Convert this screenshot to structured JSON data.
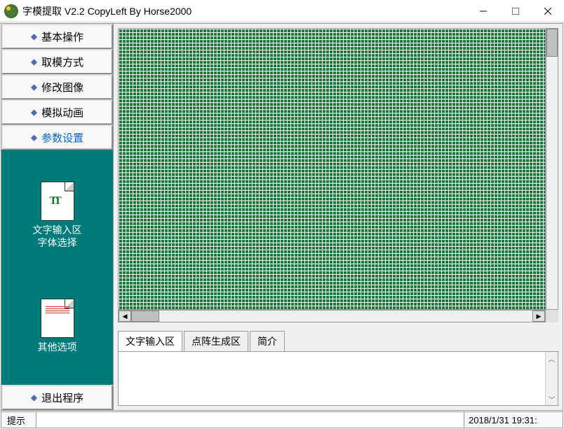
{
  "titlebar": {
    "title": "字模提取 V2.2  CopyLeft By Horse2000"
  },
  "sidebar": {
    "menu_items": [
      {
        "label": "基本操作",
        "active": false
      },
      {
        "label": "取模方式",
        "active": false
      },
      {
        "label": "修改图像",
        "active": false
      },
      {
        "label": "模拟动画",
        "active": false
      },
      {
        "label": "参数设置",
        "active": true
      }
    ],
    "teal_items": [
      {
        "label": "文字输入区\n字体选择",
        "icon": "tt"
      },
      {
        "label": "其他选项",
        "icon": "note"
      }
    ],
    "exit_label": "退出程序"
  },
  "tabs": [
    {
      "label": "文字输入区",
      "active": true
    },
    {
      "label": "点阵生成区",
      "active": false
    },
    {
      "label": "简介",
      "active": false
    }
  ],
  "statusbar": {
    "left": "提示",
    "right": "2018/1/31 19:31:"
  }
}
